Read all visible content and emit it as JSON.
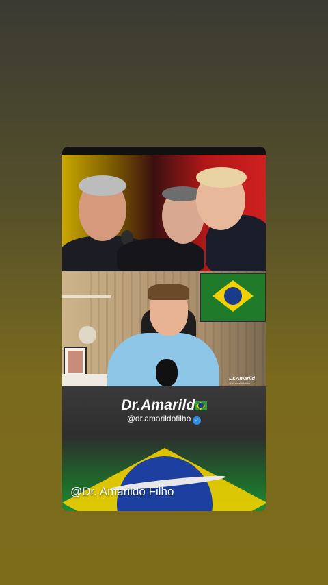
{
  "post": {
    "brand_name": "Dr.Amarild",
    "handle": "@dr.amarildofilho",
    "verified_icon": "verified-check-icon",
    "caption": "@Dr. Amarildo Filho"
  },
  "video": {
    "watermark_name": "Dr.Amarild",
    "watermark_handle": "@dr.amarildofilho"
  },
  "colors": {
    "verified_blue": "#2c8fe8",
    "flag_green": "#1d8a36",
    "flag_yellow": "#f2cf00",
    "flag_blue": "#1d3fa0"
  }
}
